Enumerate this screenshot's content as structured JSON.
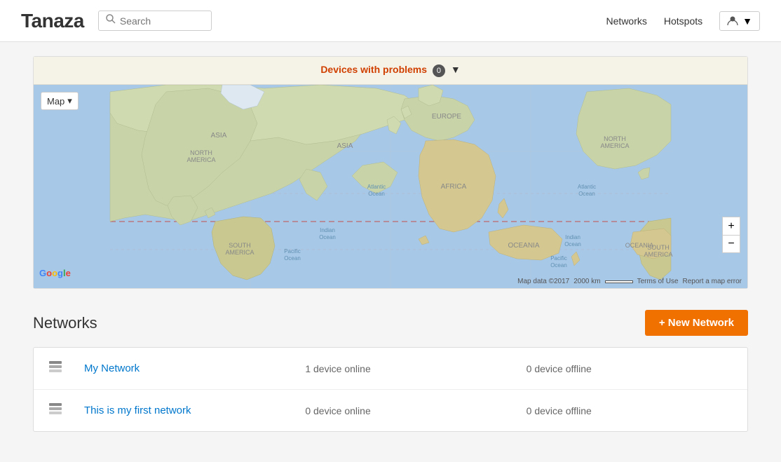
{
  "header": {
    "logo": "Tanaza",
    "search_placeholder": "Search",
    "nav": {
      "networks_label": "Networks",
      "hotspots_label": "Hotspots"
    },
    "user_icon": "▼"
  },
  "map_section": {
    "devices_problems_label": "Devices with problems",
    "problems_count": "0",
    "map_type": "Map",
    "map_type_chevron": "▾",
    "map_data_text": "Map data ©2017",
    "map_scale_text": "2000 km",
    "terms_text": "Terms of Use",
    "report_text": "Report a map error",
    "zoom_in": "+",
    "zoom_out": "−",
    "region_labels": [
      "ASIA",
      "NORTH AMERICA",
      "EUROPE",
      "AFRICA",
      "SOUTH AMERICA",
      "OCEANIA",
      "NORTH AMERICA",
      "SOUTH AMERICA",
      "OCEANIA",
      "ASIA"
    ],
    "ocean_labels": [
      "Atlantic Ocean",
      "Indian Ocean",
      "Pacific Ocean",
      "Atlantic Ocean",
      "Indian Ocean",
      "Pacific Ocean"
    ]
  },
  "networks_section": {
    "title": "Networks",
    "new_network_button": "+ New Network",
    "items": [
      {
        "name": "My Network",
        "online": "1 device online",
        "offline": "0 device offline"
      },
      {
        "name": "This is my first network",
        "online": "0 device online",
        "offline": "0 device offline"
      }
    ]
  }
}
